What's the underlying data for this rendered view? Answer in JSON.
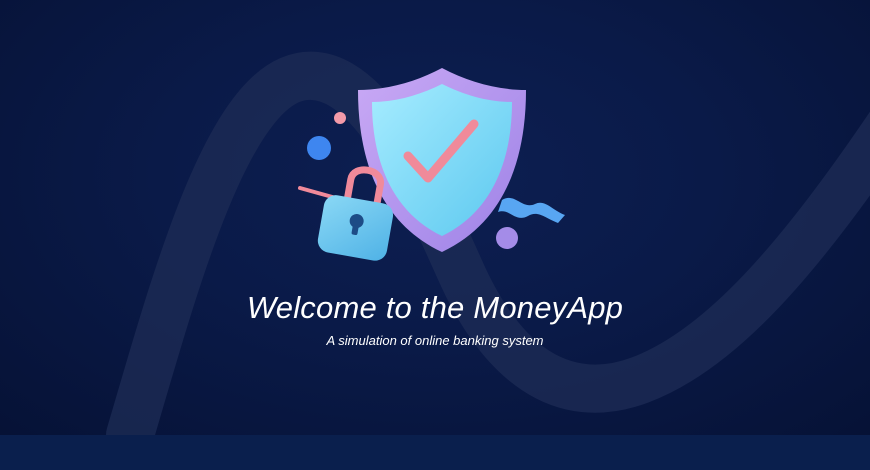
{
  "hero": {
    "title": "Welcome to the MoneyApp",
    "subtitle": "A simulation of online banking system"
  },
  "illustration": {
    "icons": [
      "shield-check-icon",
      "padlock-icon"
    ]
  },
  "colors": {
    "background": "#0a1a48",
    "footer": "#0a1f4d",
    "shield_face": "#7fdcf5",
    "shield_rim": "#b99cf0",
    "check": "#f08a9a",
    "lock_body": "#6fc6ee",
    "lock_shackle": "#f08a9a",
    "text": "#ffffff"
  }
}
